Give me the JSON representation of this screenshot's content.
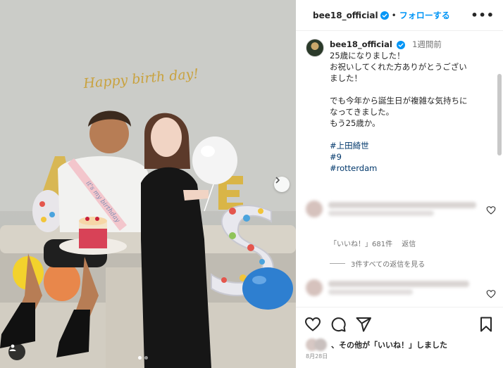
{
  "post": {
    "username": "bee18_official",
    "separator": "•",
    "follow_label": "フォローする",
    "more_label": "•••",
    "time_ago": "1週間前",
    "caption_lines": [
      "25歳になりました！",
      "お祝いしてくれた方ありがとうござい",
      "ました！",
      "",
      "でも今年から誕生日が複雑な気持ちに",
      "なってきました。",
      "もう25歳か。",
      ""
    ],
    "hashtags": [
      "#上田綺世",
      "#9",
      "#rotterdam"
    ],
    "banner_text": "Happy birth day!",
    "sash_text": "it's my birthday",
    "balloon_letters": [
      "A",
      "E",
      "S"
    ]
  },
  "comments": {
    "likes_label": "「いいね！」681件",
    "reply_label": "返信",
    "view_replies_label": "3件すべての返信を見る"
  },
  "footer": {
    "liked_by_text": "、その他が「いいね！」しました",
    "date": "8月28日"
  },
  "icons": [
    "verified-badge-icon",
    "heart-icon",
    "comment-icon",
    "share-icon",
    "bookmark-icon",
    "chevron-right-icon",
    "user-tag-icon",
    "more-icon"
  ],
  "colors": {
    "accent": "#0095f6",
    "verified": "#0095f6",
    "text": "#262626",
    "muted": "#737373",
    "link": "#00376b"
  }
}
